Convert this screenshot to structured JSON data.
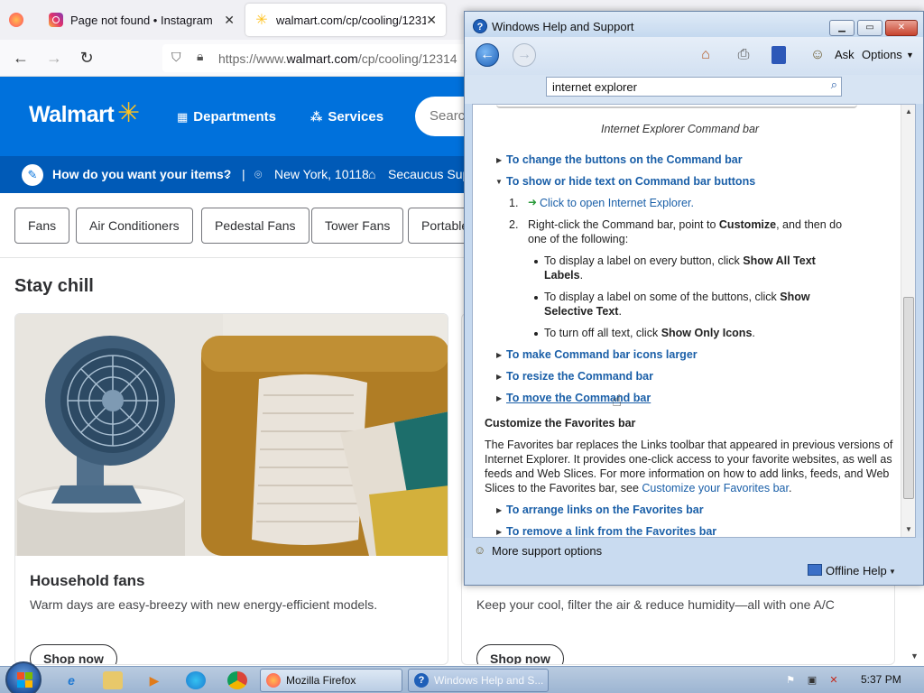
{
  "browser": {
    "tabs": [
      {
        "title": "",
        "icon": "firefox-icon"
      },
      {
        "title": "Page not found • Instagram",
        "icon": "instagram-icon"
      },
      {
        "title": "walmart.com/cp/cooling/1231",
        "icon": "walmart-spark-icon"
      }
    ],
    "url_prefix": "https://www.",
    "url_domain": "walmart.com",
    "url_path": "/cp/cooling/12314"
  },
  "walmart": {
    "logo": "Walmart",
    "departments": "Departments",
    "services": "Services",
    "search_placeholder": "Searc",
    "delivery_question": "How do you want your items?",
    "delivery_separator": "|",
    "location": "New York, 10118",
    "store": "Secaucus Supe",
    "chips": [
      "Fans",
      "Air Conditioners",
      "Pedestal Fans",
      "Tower Fans",
      "Portable"
    ],
    "section_title": "Stay chill",
    "cards": [
      {
        "title": "Household fans",
        "desc": "Warm days are easy-breezy with new energy-efficient models.",
        "button": "Shop now"
      },
      {
        "title": "",
        "desc": "Keep your cool, filter the air & reduce humidity—all with one A/C",
        "button": "Shop now"
      }
    ]
  },
  "help": {
    "title": "Windows Help and Support",
    "toolbar": {
      "ask": "Ask",
      "options": "Options"
    },
    "search_value": "internet explorer",
    "caption": "Internet Explorer Command bar",
    "link_change_buttons": "To change the buttons on the Command bar",
    "link_show_hide": "To show or hide text on Command bar buttons",
    "step1_num": "1.",
    "step1_text": "Click to open Internet Explorer.",
    "step2_num": "2.",
    "step2_pre": "Right-click the Command bar, point to ",
    "step2_bold": "Customize",
    "step2_post": ", and then do",
    "step2_line2": "one of the following:",
    "bullet1_pre": "To display a label on every button, click ",
    "bullet1_bold_a": "Show All Text",
    "bullet1_bold_b": "Labels",
    "bullet1_end": ".",
    "bullet2_pre": "To display a label on some of the buttons, click ",
    "bullet2_bold_a": "Show",
    "bullet2_bold_b": "Selective Text",
    "bullet2_end": ".",
    "bullet3_pre": "To turn off all text, click ",
    "bullet3_bold": "Show Only Icons",
    "bullet3_end": ".",
    "link_icons_larger": "To make Command bar icons larger",
    "link_resize": "To resize the Command bar",
    "link_move": "To move the Command bar",
    "favorites_heading": "Customize the Favorites bar",
    "fav_p1": "The Favorites bar replaces the Links toolbar that appeared in previous versions of",
    "fav_p2": "Internet Explorer. It provides one-click access to your favorite websites, as well as",
    "fav_p3": "feeds and Web Slices. For more information on how to add links, feeds, and Web",
    "fav_p4_pre": "Slices to the Favorites bar, see ",
    "fav_p4_link": "Customize your Favorites bar",
    "fav_p4_end": ".",
    "link_arrange": "To arrange links on the Favorites bar",
    "link_remove": "To remove a link from the Favorites bar",
    "more_support": "More support options",
    "offline_help": "Offline Help"
  },
  "taskbar": {
    "buttons": [
      "Mozilla Firefox",
      "Windows Help and S..."
    ],
    "clock": "5:37 PM"
  },
  "colors": {
    "walmart_blue": "#0071dc",
    "walmart_yellow": "#ffc220",
    "help_link": "#1a5fa8"
  }
}
